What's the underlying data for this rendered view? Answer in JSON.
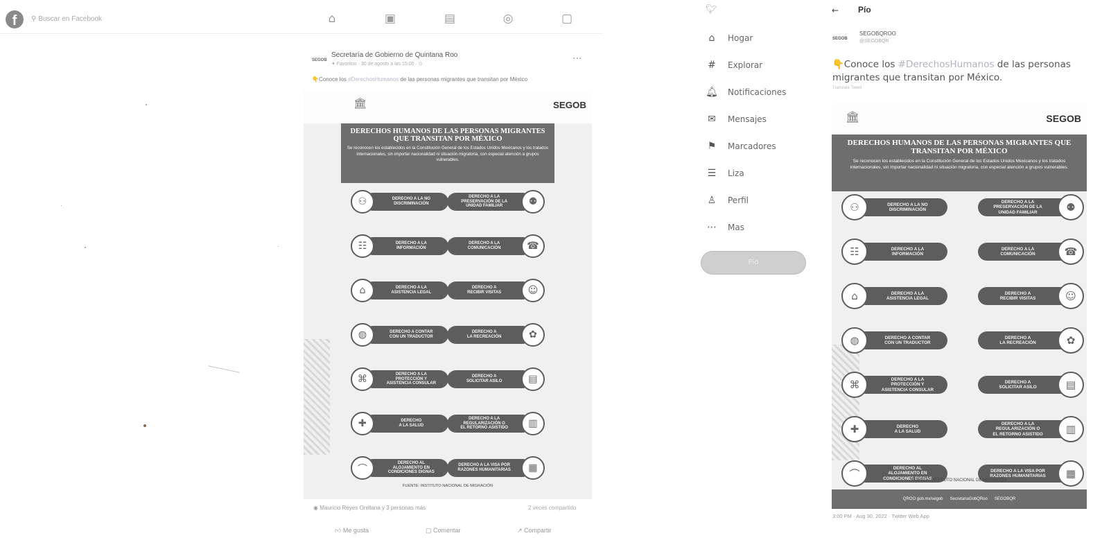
{
  "facebook": {
    "logo": "f",
    "search_placeholder": "Buscar en Facebook",
    "nav_icons": [
      "home-icon",
      "video-icon",
      "marketplace-icon",
      "groups-icon",
      "gaming-icon"
    ],
    "post": {
      "logo_text": "SEGOB",
      "author": "Secretaría de Gobierno de Quintana Roo",
      "meta": "✦ Favoritos · 30 de agosto a las 15:00 · ⊙",
      "text_prefix": "👇Conoce los ",
      "hashtag": "#DerechosHumanos",
      "text_suffix": " de las personas migrantes que transitan por México",
      "reactions": "Mauricio Reyes Orellana y 3 personas más",
      "shares": "2 veces compartido",
      "actions": [
        "Me gusta",
        "Comentar",
        "Compartir"
      ]
    }
  },
  "infographic": {
    "brand": "SEGOB",
    "title": "DERECHOS HUMANOS DE LAS PERSONAS MIGRANTES QUE TRANSITAN POR MÉXICO",
    "subtitle": "Se reconocen los establecidos en la Constitución General de los Estados Unidos Mexicanos y los tratados internacionales, sin importar nacionalidad ni situación migratoria, con especial atención a grupos vulnerables.",
    "rights_left": [
      "DERECHO A LA NO\nDISCRIMINACIÓN",
      "DERECHO A LA\nINFORMACIÓN",
      "DERECHO A LA\nASISTENCIA LEGAL",
      "DERECHO A CONTAR\nCON UN TRADUCTOR",
      "DERECHO A LA\nPROTECCIÓN Y\nASISTENCIA CONSULAR",
      "DERECHO\nA LA SALUD",
      "DERECHO AL\nALOJAMIENTO EN\nCONDICIONES DIGNAS"
    ],
    "rights_right": [
      "DERECHO A LA\nPRESERVACIÓN DE LA\nUNIDAD FAMILIAR",
      "DERECHO A LA\nCOMUNICACIÓN",
      "DERECHO A\nRECIBIR VISITAS",
      "DERECHO A\nLA RECREACIÓN",
      "DERECHO A\nSOLICITAR ASILO",
      "DERECHO A LA\nREGULARIZACIÓN O\nEL RETORNO ASISTIDO",
      "DERECHO A LA VISA POR\nRAZONES HUMANITARIAS"
    ],
    "source": "FUENTE: INSTITUTO NACIONAL DE MIGRACIÓN",
    "footer_links": [
      "QROO gob.mx/segob",
      "SecretariaGobQRoo",
      "SEGOBQR"
    ]
  },
  "twitter": {
    "nav": [
      {
        "icon": "home-icon",
        "label": "Hogar"
      },
      {
        "icon": "explore-icon",
        "label": "Explorar"
      },
      {
        "icon": "notifications-icon",
        "label": "Notificaciones"
      },
      {
        "icon": "messages-icon",
        "label": "Mensajes"
      },
      {
        "icon": "bookmarks-icon",
        "label": "Marcadores"
      },
      {
        "icon": "lists-icon",
        "label": "Liza"
      },
      {
        "icon": "profile-icon",
        "label": "Perfil"
      },
      {
        "icon": "more-icon",
        "label": "Mas"
      }
    ],
    "post_button": "Pío",
    "header_title": "Pío",
    "account": {
      "logo_text": "SEGOB",
      "name": "SEGOBQROO",
      "handle": "@SEGOBQR"
    },
    "text_prefix": "👇Conoce los ",
    "hashtag": "#DerechosHumanos",
    "text_suffix": " de las personas migrantes que transitan por México.",
    "translate": "Translate Tweet",
    "timestamp": "3:00 PM · Aug 30, 2022 · Twitter Web App"
  }
}
